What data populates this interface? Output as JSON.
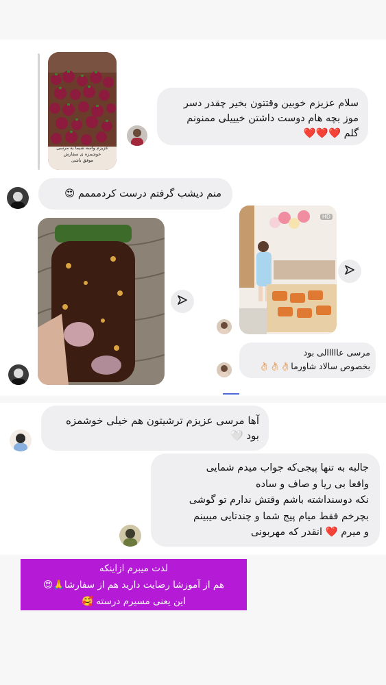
{
  "messages": {
    "m1": {
      "lines": [
        "سلام عزیزم خوبین وقتتون بخیر چقدر دسر",
        "موز بچه هام دوست داشتن خیییلی ممنونم",
        "گلم ❤️❤️❤️"
      ]
    },
    "m2": {
      "text": "منم دیشب گرفتم درست کردمممم 😍"
    },
    "m3": {
      "lines": [
        "مرسی عااااالی بود",
        "بخصوص سالاد شاورما👌🏻👌🏻👌🏻"
      ]
    },
    "m4": {
      "lines": [
        "آها مرسی عزیزم ترشیتون هم خیلی خوشمزه",
        "بود 🤍"
      ]
    },
    "m5": {
      "lines": [
        "جالبه به تنها پیجی‌که جواب میدم شمایی",
        "واقعا بی ریا و صاف و ساده",
        "نکه دوسنداشته باشم وقتش ندارم تو گوشی",
        "بچرخم فقط میام پیج شما و چندتایی میبینم",
        "و میرم ❤️ انقدر که مهربونی"
      ]
    }
  },
  "story_card": {
    "caption_lines": [
      "عزیزم واسه شیما به مرسی",
      "خوشمزه ی سفارش",
      "موفق باشی"
    ]
  },
  "hd_badge": "HD",
  "footer_note": {
    "lines": [
      "لذت میبرم ازاینکه",
      "هم از آموزشا رضایت دارید هم از سفارشا🙏😍",
      "این یعنی مسیرم درسته 🥰"
    ]
  },
  "colors": {
    "bubble": "#efeff2",
    "note_bg": "#b51ad6",
    "note_text": "#ffffff",
    "background": "#f7f7f8"
  }
}
